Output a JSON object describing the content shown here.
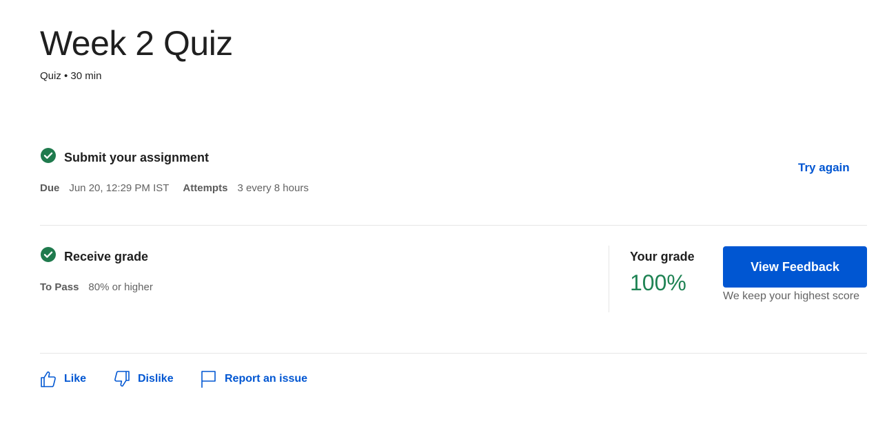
{
  "header": {
    "title": "Week 2 Quiz",
    "subtitle": "Quiz • 30 min"
  },
  "submit_step": {
    "title": "Submit your assignment",
    "due_label": "Due",
    "due_value": "Jun 20, 12:29 PM IST",
    "attempts_label": "Attempts",
    "attempts_value": "3 every 8 hours",
    "try_again_label": "Try again"
  },
  "grade_step": {
    "title": "Receive grade",
    "to_pass_label": "To Pass",
    "to_pass_value": "80% or higher",
    "your_grade_label": "Your grade",
    "your_grade_value": "100%",
    "view_feedback_label": "View Feedback",
    "highest_score_note": "We keep your highest score"
  },
  "actions": {
    "like_label": "Like",
    "dislike_label": "Dislike",
    "report_label": "Report an issue"
  },
  "colors": {
    "accent": "#0056d2",
    "success": "#1f8354",
    "check": "#1f7a4d"
  },
  "icons": {
    "check": "check-circle-icon",
    "like": "thumbs-up-icon",
    "dislike": "thumbs-down-icon",
    "report": "flag-icon"
  }
}
